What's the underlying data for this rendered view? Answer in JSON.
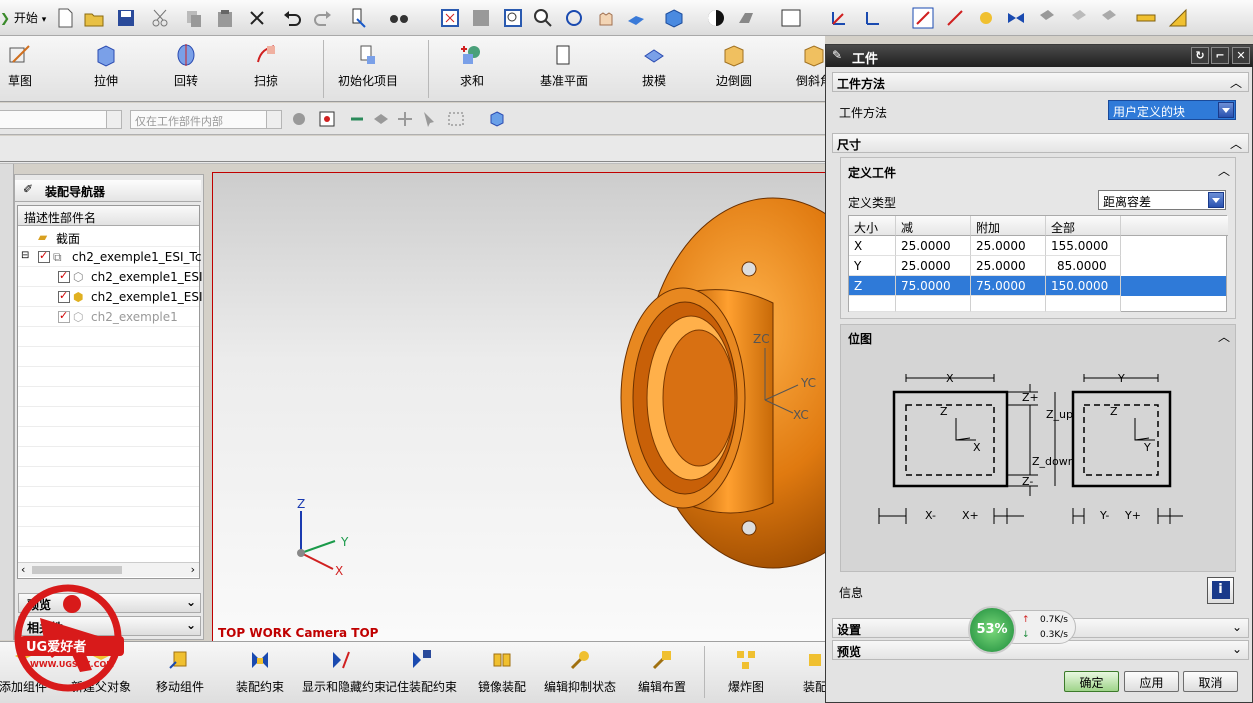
{
  "toolbar": {
    "start_label": "开始"
  },
  "ribbon": {
    "items": [
      {
        "label": "草图"
      },
      {
        "label": "拉伸"
      },
      {
        "label": "回转"
      },
      {
        "label": "扫掠"
      },
      {
        "label": "初始化项目"
      },
      {
        "label": "求和"
      },
      {
        "label": "基准平面"
      },
      {
        "label": "拔模"
      },
      {
        "label": "边倒圆"
      },
      {
        "label": "倒斜角"
      }
    ]
  },
  "filterbar": {
    "scope_combo": "仅在工作部件内部"
  },
  "navigator": {
    "title": "装配导航器",
    "column_header": "描述性部件名",
    "rows": [
      {
        "label": "截面"
      },
      {
        "label": "ch2_exemple1_ESI_Tc"
      },
      {
        "label": "ch2_exemple1_ESI"
      },
      {
        "label": "ch2_exemple1_ESI"
      },
      {
        "label": "ch2_exemple1"
      }
    ],
    "preview_label": "预览",
    "dependency_label": "相关性"
  },
  "viewport": {
    "label": "TOP WORK Camera TOP",
    "wcs_labels": [
      "ZC",
      "YC",
      "XC"
    ],
    "axis_labels": [
      "Z",
      "Y",
      "X"
    ]
  },
  "bottom_toolbar": {
    "items": [
      {
        "label": "添加组件"
      },
      {
        "label": "新建父对象"
      },
      {
        "label": "移动组件"
      },
      {
        "label": "装配约束"
      },
      {
        "label": "显示和隐藏约束"
      },
      {
        "label": "记住装配约束"
      },
      {
        "label": "镜像装配"
      },
      {
        "label": "编辑抑制状态"
      },
      {
        "label": "编辑布置"
      },
      {
        "label": "爆炸图"
      },
      {
        "label": "装配"
      }
    ]
  },
  "dialog": {
    "title": "工件",
    "section_method": "工件方法",
    "method_label": "工件方法",
    "method_value": "用户定义的块",
    "section_size": "尺寸",
    "section_define": "定义工件",
    "define_type_label": "定义类型",
    "define_type_value": "距离容差",
    "grid_headers": [
      "大小",
      "减",
      "附加",
      "全部"
    ],
    "grid_rows": [
      [
        "X",
        "25.0000",
        "25.0000",
        "155.0000"
      ],
      [
        "Y",
        "25.0000",
        "25.0000",
        "85.0000"
      ],
      [
        "Z",
        "75.0000",
        "75.0000",
        "150.0000"
      ]
    ],
    "section_diagram": "位图",
    "diagram_labels": {
      "x": "X",
      "y": "Y",
      "zplus": "Z+",
      "zup": "Z_up",
      "zdown": "Z_down",
      "zminus": "Z-",
      "xminus": "X-",
      "xplus": "X+",
      "yminus": "Y-",
      "yplus": "Y+",
      "z_small": "Z",
      "x_small": "X",
      "y_small": "Y"
    },
    "info_label": "信息",
    "section_settings": "设置",
    "section_preview": "预览",
    "ok": "确定",
    "apply": "应用",
    "cancel": "取消"
  },
  "net": {
    "percent": "53%",
    "up": "0.7K/s",
    "down": "0.3K/s"
  },
  "watermark": {
    "brand": "UG爱好者",
    "url": "WWW.UGSNX.COM"
  }
}
